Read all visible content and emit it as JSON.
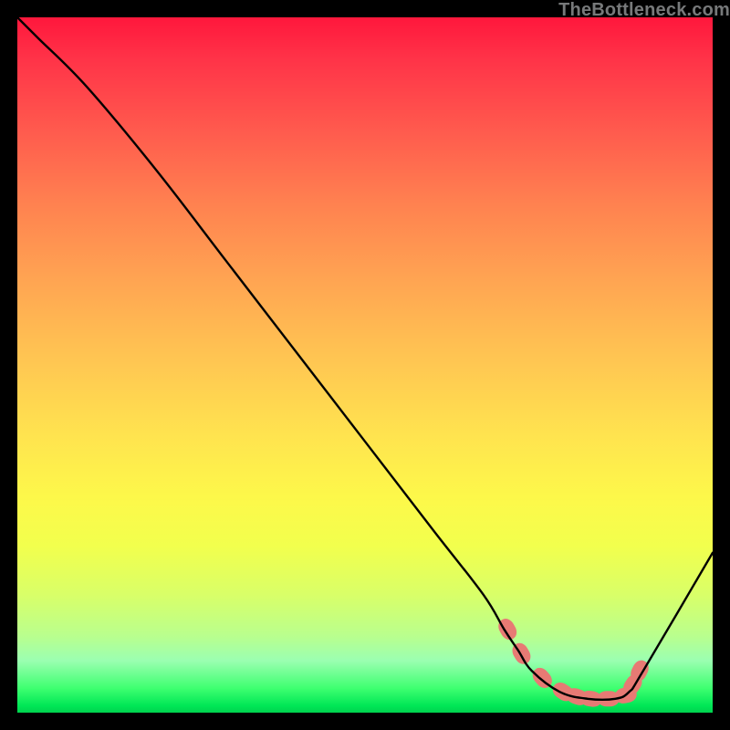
{
  "watermark": "TheBottleneck.com",
  "chart_data": {
    "type": "line",
    "title": "",
    "xlabel": "",
    "ylabel": "",
    "xlim": [
      0,
      100
    ],
    "ylim": [
      0,
      100
    ],
    "legend_position": "none",
    "grid": false,
    "series": [
      {
        "name": "bottleneck-curve",
        "color": "#000000",
        "x": [
          0,
          3,
          10,
          20,
          30,
          40,
          50,
          60,
          67,
          70,
          72,
          74,
          78,
          82,
          86,
          88,
          90,
          100
        ],
        "y": [
          100,
          97,
          90,
          78,
          65,
          52,
          39,
          26,
          17,
          12,
          9,
          6,
          3,
          2,
          2,
          3,
          6,
          23
        ]
      }
    ],
    "markers": {
      "name": "highlight-dots",
      "color": "#e77a74",
      "shape": "rounded-rect",
      "x": [
        70.5,
        72.5,
        75.5,
        78.5,
        80.5,
        82.5,
        85.0,
        87.5,
        88.5,
        89.5
      ],
      "y": [
        12,
        8.5,
        5,
        3,
        2.3,
        2,
        2,
        2.5,
        4,
        6
      ]
    },
    "gradient_stops": [
      {
        "pos": 0.0,
        "color": "#ff173c"
      },
      {
        "pos": 0.17,
        "color": "#ff5d4e"
      },
      {
        "pos": 0.38,
        "color": "#ffa552"
      },
      {
        "pos": 0.6,
        "color": "#ffe34f"
      },
      {
        "pos": 0.76,
        "color": "#f2ff4d"
      },
      {
        "pos": 0.9,
        "color": "#b9ff8e"
      },
      {
        "pos": 0.97,
        "color": "#3eff70"
      },
      {
        "pos": 1.0,
        "color": "#00d24e"
      }
    ]
  }
}
